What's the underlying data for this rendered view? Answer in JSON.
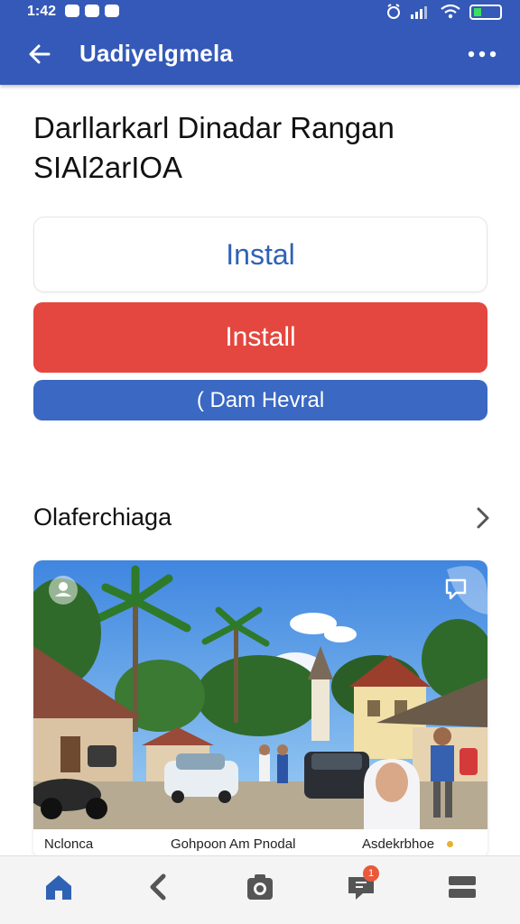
{
  "status_bar": {
    "time": "1:42",
    "icons": [
      "notification-icon",
      "chat-icon",
      "camera-icon"
    ],
    "right_icons": [
      "alarm-icon",
      "signal-icon",
      "wifi-icon",
      "battery-icon"
    ],
    "battery_level": 0.2
  },
  "app_bar": {
    "title": "Uadiyelgmela",
    "back_icon": "back-arrow-icon",
    "menu_icon": "more-dots-icon"
  },
  "page": {
    "heading_line1": "Darllarkarl Dinadar Rangan",
    "heading_line2": "SIAl2arIOA"
  },
  "buttons": {
    "primary_outline_label": "Instal",
    "primary_red_label": "Install",
    "secondary_blue_label": "( Dam Hevral"
  },
  "section": {
    "title": "Olaferchiaga",
    "chevron_icon": "chevron-right-icon"
  },
  "card": {
    "caption_left": "Nclonca",
    "caption_middle": "Gohpoon Am Pnodal",
    "caption_right": "Asdekrbhoe",
    "overlay_left_icon": "user-icon",
    "overlay_right_icon": "message-icon"
  },
  "bottom_nav": {
    "items": [
      {
        "icon": "home-icon",
        "active": true
      },
      {
        "icon": "back-icon",
        "active": false
      },
      {
        "icon": "camera-icon",
        "active": false
      },
      {
        "icon": "notification-chat-icon",
        "badge": "1",
        "active": false
      },
      {
        "icon": "menu-icon",
        "active": false
      }
    ]
  },
  "colors": {
    "app_bar": "#3459b8",
    "red_button": "#e4473f",
    "blue_button": "#3a68c2",
    "outline_text": "#2f62b5",
    "home_active": "#2f62b5"
  }
}
